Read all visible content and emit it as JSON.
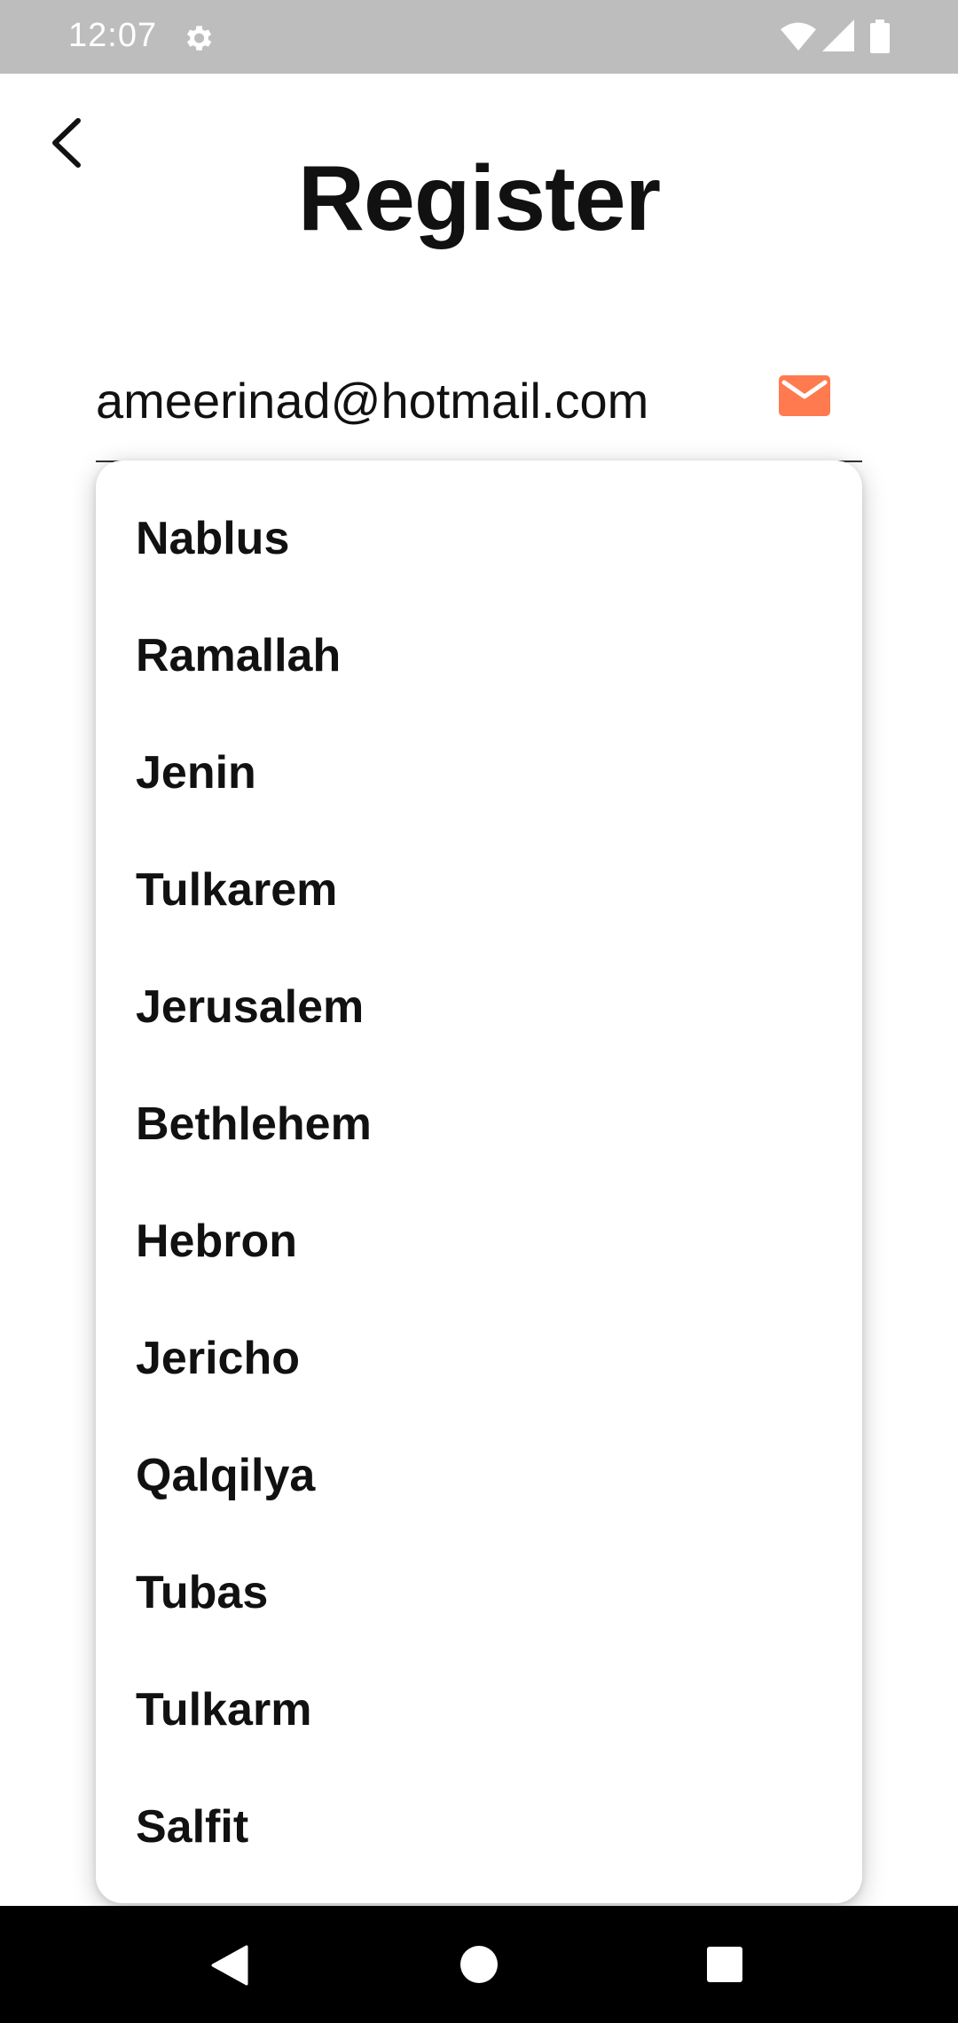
{
  "status_bar": {
    "time": "12:07",
    "icons": [
      "gear-icon",
      "wifi-icon",
      "signal-icon",
      "battery-icon"
    ]
  },
  "header": {
    "back_icon": "chevron-left-icon",
    "title": "Register"
  },
  "email_field": {
    "value": "ameerinad@hotmail.com",
    "icon": "mail-icon",
    "icon_color": "#FF7A4F"
  },
  "dropdown": {
    "items": [
      {
        "label": "Nablus"
      },
      {
        "label": "Ramallah"
      },
      {
        "label": "Jenin"
      },
      {
        "label": "Tulkarem"
      },
      {
        "label": "Jerusalem"
      },
      {
        "label": "Bethlehem"
      },
      {
        "label": "Hebron"
      },
      {
        "label": "Jericho"
      },
      {
        "label": "Qalqilya"
      },
      {
        "label": "Tubas"
      },
      {
        "label": "Tulkarm"
      },
      {
        "label": "Salfit"
      }
    ]
  },
  "nav_bar": {
    "icons": [
      "nav-back-icon",
      "nav-home-icon",
      "nav-recents-icon"
    ]
  }
}
